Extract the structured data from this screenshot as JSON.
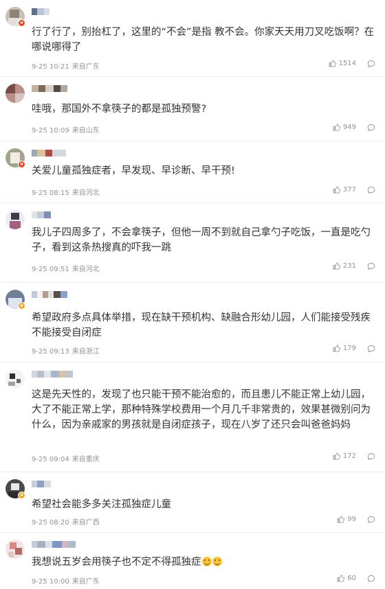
{
  "comments": [
    {
      "text": "行了行了，别抬杠了，这里的“不会”是指 教不会。你家天天用刀叉吃饭啊？在哪说哪得了",
      "time": "9-25 10:21",
      "location": "来自广东",
      "likes": "1514"
    },
    {
      "text": "哇哦，那国外不拿筷子的都是孤独预警?",
      "time": "9-25 10:09",
      "location": "来自山东",
      "likes": "949"
    },
    {
      "text": "关爱儿童孤独症者，早发现、早诊断、早干预!",
      "time": "9-25 08:15",
      "location": "来自河北",
      "likes": "377"
    },
    {
      "text": "我儿子四周多了，不会拿筷子，但他一周不到就自己拿勺子吃饭，一直是吃勺子，看到这条热搜真的吓我一跳",
      "time": "9-25 09:51",
      "location": "来自河北",
      "likes": "231"
    },
    {
      "text": "希望政府多点具体举措，现在缺干预机构、缺融合形幼儿园，人们能接受残疾不能接受自闭症",
      "time": "9-25 09:13",
      "location": "来自浙江",
      "likes": "179"
    },
    {
      "text": "这是先天性的，发现了也只能干预不能治愈的，而且患儿不能正常上幼儿园，大了不能正常上学，那种特殊学校费用一个月几千非常贵的，效果甚微别问为什么，因为亲戚家的男孩就是自闭症孩子，现在八岁了还只会叫爸爸妈妈",
      "time": "9-25 09:04",
      "location": "来自重庆",
      "likes": "172"
    },
    {
      "text": "希望社会能多多关注孤独症儿童",
      "time": "9-25 08:20",
      "location": "来自广西",
      "likes": "99"
    },
    {
      "text": "我想说五岁会用筷子也不定不得孤独症",
      "time": "9-25 10:00",
      "location": "来自广东",
      "likes": "60"
    }
  ],
  "icons": {
    "like": "thumbs-up-icon",
    "reply": "comment-bubble-icon",
    "verified": "verified-badge-icon"
  }
}
